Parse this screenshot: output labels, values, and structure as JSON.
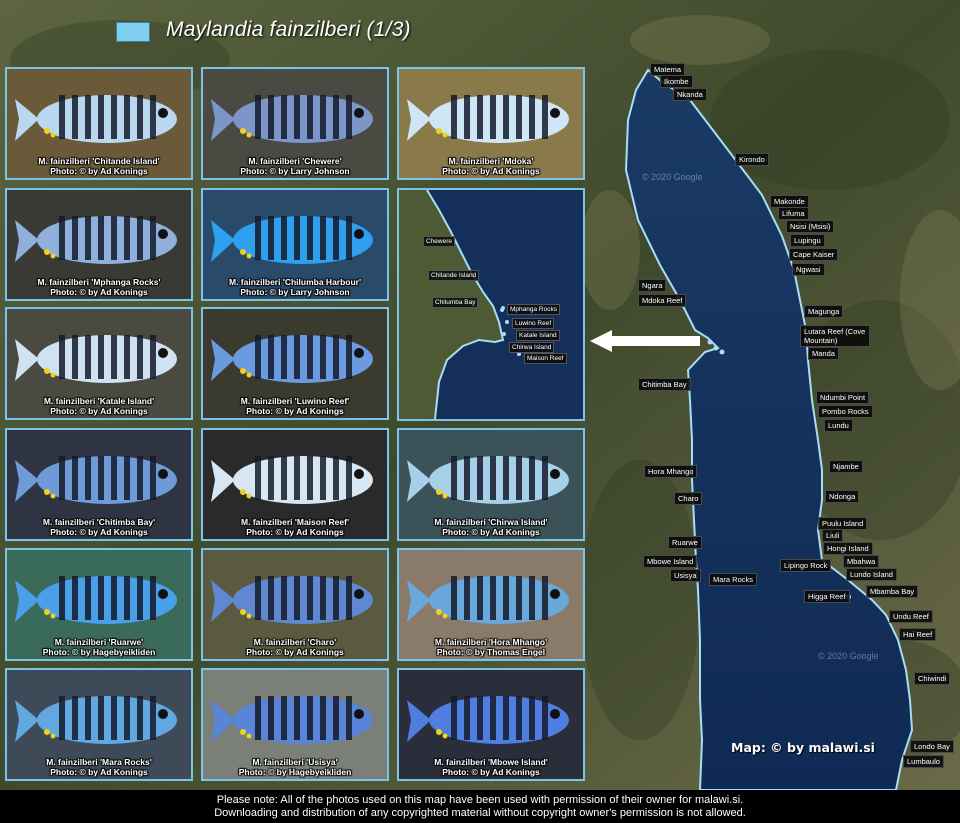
{
  "title": "Maylandia fainzilberi (1/3)",
  "map_credit": "Map: © by malawi.si",
  "watermarks": [
    "© 2020 Google",
    "© 2020 Google"
  ],
  "footer": {
    "line1": "Please note: All of the photos used on this map have been used with permission of their owner for malawi.si.",
    "line2": "Downloading and distribution of any copyrighted material without copyright owner's permission is not allowed."
  },
  "colors": {
    "lake": "#12305a",
    "shore": "#9fd8f0",
    "card_border": "#79c4e8",
    "land": "#4a5230"
  },
  "photos": [
    {
      "name": "M. fainzilberi 'Chitande Island'",
      "credit": "Photo: © by Ad Konings"
    },
    {
      "name": "M. fainzilberi 'Chewere'",
      "credit": "Photo: © by Larry Johnson"
    },
    {
      "name": "M. fainzilberi 'Mdoka'",
      "credit": "Photo: © by Ad Konings"
    },
    {
      "name": "M. fainzilberi 'Mphanga Rocks'",
      "credit": "Photo: © by Ad Konings"
    },
    {
      "name": "M. fainzilberi 'Chilumba Harbour'",
      "credit": "Photo: © by Larry Johnson"
    },
    {
      "name": "M. fainzilberi 'Katale Island'",
      "credit": "Photo: © by Ad Konings"
    },
    {
      "name": "M. fainzilberi 'Luwino Reef'",
      "credit": "Photo: © by Ad Konings"
    },
    {
      "name": "M. fainzilberi 'Chitimba Bay'",
      "credit": "Photo: © by Ad Konings"
    },
    {
      "name": "M. fainzilberi 'Maison Reef'",
      "credit": "Photo: © by Ad Konings"
    },
    {
      "name": "M. fainzilberi 'Chirwa Island'",
      "credit": "Photo: © by Ad Konings"
    },
    {
      "name": "M. fainzilberi 'Ruarwe'",
      "credit": "Photo: © by Hagebyeikliden"
    },
    {
      "name": "M. fainzilberi 'Charo'",
      "credit": "Photo: © by Ad Konings"
    },
    {
      "name": "M. fainzilberi 'Hora Mhango'",
      "credit": "Photo: © by Thomas Engel"
    },
    {
      "name": "M. fainzilberi 'Mara Rocks'",
      "credit": "Photo: © by Ad Konings"
    },
    {
      "name": "M. fainzilberi 'Usisya'",
      "credit": "Photo: © by Hagebyeikliden"
    },
    {
      "name": "M. fainzilberi 'Mbowe Island'",
      "credit": "Photo: © by Ad Konings"
    }
  ],
  "inset_labels": [
    "Chewere",
    "Chitande Island",
    "Chilumba Bay",
    "Mphanga Rocks",
    "Luwino Reef",
    "Katale Island",
    "Chirwa Island",
    "Maison Reef"
  ],
  "map_labels": [
    "Matema",
    "Ikombe",
    "Nkanda",
    "Kirondo",
    "Makonde",
    "Lifuma",
    "Nsisi (Msisi)",
    "Lupingu",
    "Cape Kaiser",
    "Ngwasi",
    "Ngara",
    "Mdoka Reef",
    "Magunga",
    "Lutara Reef (Cove Mountain)",
    "Manda",
    "Chitimba Bay",
    "Ndumbi Point",
    "Pombo Rocks",
    "Lundu",
    "Hora Mhango",
    "Njambe",
    "Charo",
    "Ndonga",
    "Puulu Island",
    "Liuli",
    "Ruarwe",
    "Hongi Island",
    "Mbowe Island",
    "Lipingo Rock",
    "Mbahwa",
    "Usisya",
    "Mara Rocks",
    "Lundo Island",
    "Higga Reef",
    "Mbamba Bay",
    "Undu Reef",
    "Hai Reef",
    "Chiwindi",
    "Londo Bay",
    "Lumbaulo"
  ]
}
